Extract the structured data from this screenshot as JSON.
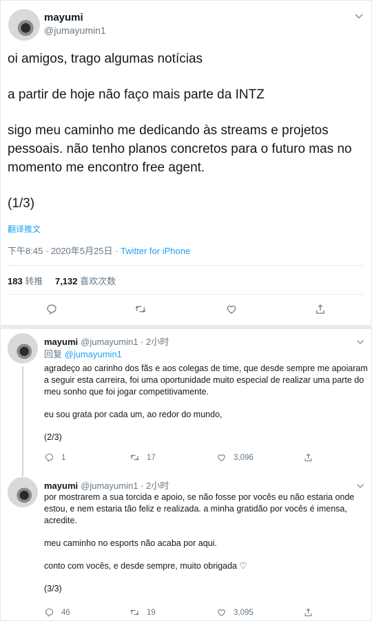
{
  "main_tweet": {
    "display_name": "mayumi",
    "handle": "@jumayumin1",
    "paragraphs": [
      "oi amigos, trago algumas notícias",
      "a partir de hoje não faço mais parte da INTZ",
      "sigo meu caminho me dedicando às streams e projetos pessoais. não tenho planos concretos para o futuro mas no momento me encontro free agent.",
      "(1/3)"
    ],
    "translate_label": "翻译推文",
    "timestamp": "下午8:45 · 2020年5月25日 · ",
    "source_app": "Twitter for iPhone",
    "retweets_count": "183",
    "retweets_label": "转推",
    "likes_count": "7,132",
    "likes_label": "喜欢次数",
    "icons": [
      "reply-icon",
      "retweet-icon",
      "like-icon",
      "share-icon"
    ]
  },
  "replies": [
    {
      "display_name": "mayumi",
      "handle": "@jumayumin1",
      "time": "· 2小时",
      "reply_to_label": "回复 ",
      "reply_to_handle": "@jumayumin1",
      "paragraphs": [
        "agradeço ao carinho dos fãs e aos colegas de time, que desde sempre me apoiaram a seguir esta carreira, foi uma oportunidade muito especial de realizar uma parte do meu sonho que foi jogar competitivamente.",
        "eu sou grata por cada um, ao redor do mundo,",
        "(2/3)"
      ],
      "reply_count": "1",
      "retweet_count": "17",
      "like_count": "3,096"
    },
    {
      "display_name": "mayumi",
      "handle": "@jumayumin1",
      "time": "· 2小时",
      "paragraphs": [
        "por mostrarem a sua torcida e apoio, se não fosse por vocês eu não estaria onde estou, e nem estaria tão feliz e realizada. a minha gratidão por vocês é imensa, acredite.",
        "meu caminho no esports não acaba por aqui.",
        "conto com vocês, e desde sempre, muito obrigada ♡",
        "(3/3)"
      ],
      "reply_count": "46",
      "retweet_count": "19",
      "like_count": "3,095"
    }
  ],
  "colors": {
    "accent": "#1da1f2",
    "muted": "#657786",
    "text": "#14171a"
  }
}
